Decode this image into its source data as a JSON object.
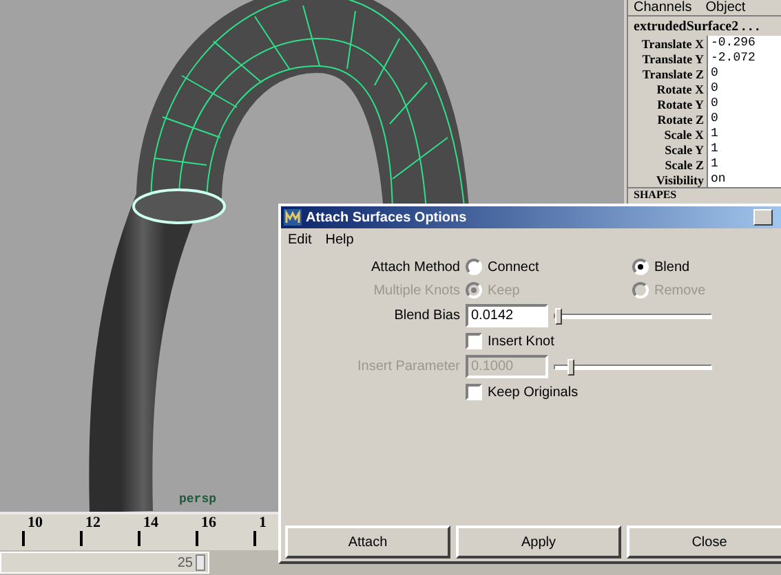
{
  "viewport": {
    "camera_label": "persp"
  },
  "channel_box": {
    "menus": [
      "Channels",
      "Object"
    ],
    "node": "extrudedSurface2 . . .",
    "channels": [
      {
        "name": "Translate X",
        "value": "-0.296"
      },
      {
        "name": "Translate Y",
        "value": "-2.072"
      },
      {
        "name": "Translate Z",
        "value": "0"
      },
      {
        "name": "Rotate X",
        "value": "0"
      },
      {
        "name": "Rotate Y",
        "value": "0"
      },
      {
        "name": "Rotate Z",
        "value": "0"
      },
      {
        "name": "Scale X",
        "value": "1"
      },
      {
        "name": "Scale Y",
        "value": "1"
      },
      {
        "name": "Scale Z",
        "value": "1"
      },
      {
        "name": "Visibility",
        "value": "on"
      }
    ],
    "section": "SHAPES"
  },
  "timeline": {
    "ticks": [
      "10",
      "12",
      "14",
      "16",
      "1"
    ]
  },
  "range_slider": {
    "end": "25"
  },
  "dialog": {
    "title": "Attach Surfaces Options",
    "menus": [
      "Edit",
      "Help"
    ],
    "rows": [
      {
        "kind": "radio",
        "label": "Attach Method",
        "disabled": false,
        "options": [
          {
            "label": "Connect",
            "selected": false
          },
          {
            "label": "Blend",
            "selected": true
          }
        ]
      },
      {
        "kind": "radio",
        "label": "Multiple Knots",
        "disabled": true,
        "options": [
          {
            "label": "Keep",
            "selected": true
          },
          {
            "label": "Remove",
            "selected": false
          }
        ]
      },
      {
        "kind": "slider",
        "label": "Blend Bias",
        "value": "0.0142",
        "level": 0.02,
        "disabled": false
      },
      {
        "kind": "checkbox",
        "label": "Insert Knot",
        "checked": false
      },
      {
        "kind": "slider",
        "label": "Insert Parameter",
        "value": "0.1000",
        "level": 0.1,
        "disabled": true
      },
      {
        "kind": "checkbox",
        "label": "Keep Originals",
        "checked": false
      }
    ],
    "buttons": [
      "Attach",
      "Apply",
      "Close"
    ]
  }
}
